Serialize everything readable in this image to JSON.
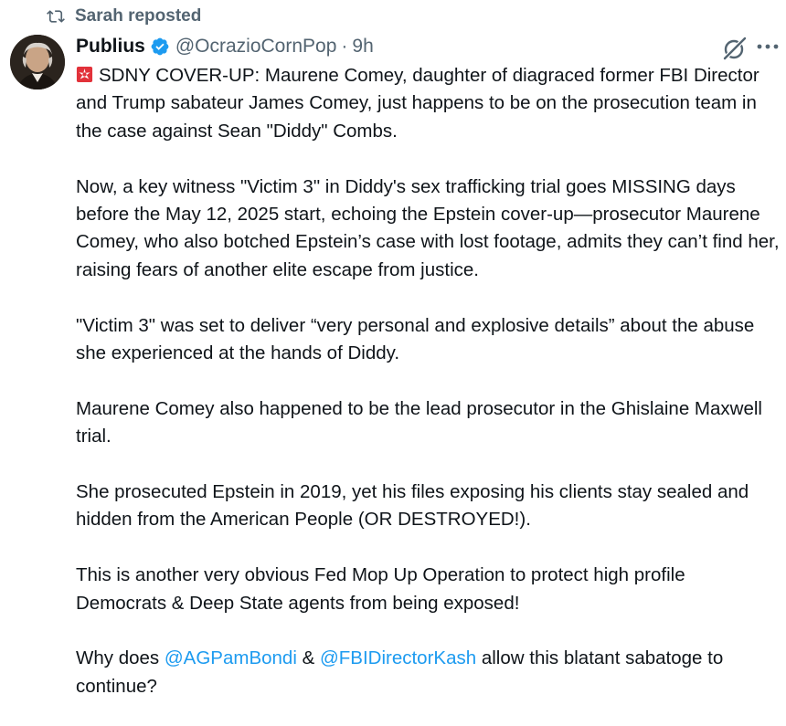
{
  "repost": {
    "label": "Sarah reposted",
    "icon": "repost-icon"
  },
  "author": {
    "name": "Publius",
    "handle": "@OcrazioCornPop",
    "separator": "·",
    "time": "9h",
    "verified_icon": "verified-badge-icon",
    "avatar": "avatar-portrait"
  },
  "actions": {
    "grok_icon": "grok-icon",
    "more_icon": "more-icon"
  },
  "tweet": {
    "lead_emoji": "siren-emoji",
    "p1": "SDNY COVER-UP:  Maurene Comey, daughter of diagraced former FBI Director and Trump sabateur James Comey, just happens to be on the prosecution team in the case against Sean \"Diddy\" Combs.",
    "p2": "Now, a key witness \"Victim 3\" in Diddy's sex trafficking trial goes MISSING days before the May 12, 2025 start, echoing the Epstein cover-up—prosecutor Maurene Comey, who also botched Epstein’s case with lost footage, admits they can’t find her, raising fears of another elite escape from justice.",
    "p3": "\"Victim 3\" was set to deliver “very personal and explosive details” about the abuse she experienced at the hands of Diddy.",
    "p4": "Maurene Comey also happened to be the lead prosecutor in the Ghislaine Maxwell trial.",
    "p5": "She prosecuted Epstein in 2019, yet his files exposing his clients stay sealed and hidden from the American People (OR DESTROYED!).",
    "p6": "This is another very obvious Fed Mop Up Operation to protect high profile Democrats & Deep State agents from being exposed!",
    "p7_prefix": "Why does ",
    "mention1": "@AGPamBondi",
    "p7_mid": " & ",
    "mention2": "@FBIDirectorKash",
    "p7_suffix": " allow this blatant sabatoge to continue?"
  },
  "colors": {
    "text": "#0f1419",
    "secondary": "#536471",
    "link": "#1d9bf0",
    "verified": "#1d9bf0"
  }
}
